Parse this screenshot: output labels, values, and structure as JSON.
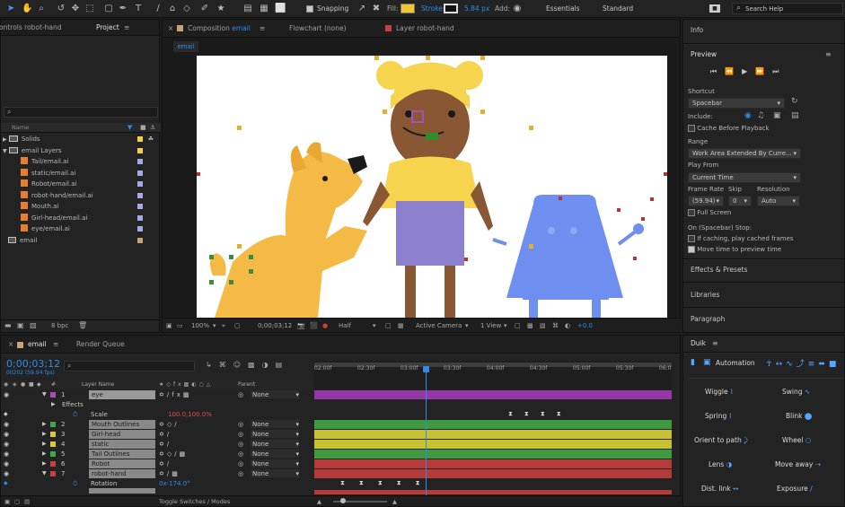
{
  "toolbar": {
    "snapping_label": "Snapping",
    "fill_label": "Fill:",
    "stroke_label": "Stroke:",
    "stroke_width": "5.84 px",
    "add_label": "Add:",
    "workspace_essentials": "Essentials",
    "workspace_standard": "Standard",
    "search_placeholder": "Search Help",
    "fill_color": "#f5c431"
  },
  "left_panel": {
    "tab_effect_controls": "ontrols robot-hand",
    "tab_project": "Project",
    "search_placeholder": "",
    "col_name": "Name",
    "items": [
      {
        "label": "Solids",
        "type": "folder",
        "color": "#f2d53c"
      },
      {
        "label": "email Layers",
        "type": "folder",
        "color": "#f2d53c"
      },
      {
        "label": "Tail/email.ai",
        "type": "ai",
        "color": "#a7a8e8"
      },
      {
        "label": "static/email.ai",
        "type": "ai",
        "color": "#a7a8e8"
      },
      {
        "label": "Robot/email.ai",
        "type": "ai",
        "color": "#a7a8e8"
      },
      {
        "label": "robot-hand/email.ai",
        "type": "ai",
        "color": "#a7a8e8"
      },
      {
        "label": "Mouth.ai",
        "type": "ai",
        "color": "#a7a8e8"
      },
      {
        "label": "Girl-head/email.ai",
        "type": "ai",
        "color": "#a7a8e8"
      },
      {
        "label": "eye/email.ai",
        "type": "ai",
        "color": "#a7a8e8"
      },
      {
        "label": "email",
        "type": "comp",
        "color": "#c8a27a"
      }
    ],
    "bpc": "8 bpc"
  },
  "comp_panel": {
    "tab_composition": "Composition",
    "tab_composition_name": "email",
    "tab_flowchart": "Flowchart (none)",
    "tab_layer": "Layer robot-hand",
    "crumb": "email",
    "zoom": "100%",
    "timecode": "0;00;03;12",
    "resolution": "Half",
    "camera": "Active Camera",
    "view": "1 View",
    "exposure": "+0.0"
  },
  "right_panel": {
    "info": "Info",
    "preview": "Preview",
    "shortcut_label": "Shortcut",
    "shortcut_value": "Spacebar",
    "include_label": "Include:",
    "cache_label": "Cache Before Playback",
    "range_label": "Range",
    "range_value": "Work Area Extended By Curre...",
    "playfrom_label": "Play From",
    "playfrom_value": "Current Time",
    "framerate_label": "Frame Rate",
    "skip_label": "Skip",
    "resolution_label": "Resolution",
    "framerate_value": "(59.94)",
    "skip_value": "0",
    "resolution_value": "Auto",
    "fullscreen_label": "Full Screen",
    "stop_label": "On (Spacebar) Stop:",
    "stop_opt1": "If caching, play cached frames",
    "stop_opt2": "Move time to preview time",
    "effects_presets": "Effects & Presets",
    "libraries": "Libraries",
    "paragraph": "Paragraph"
  },
  "timeline": {
    "tab_email": "email",
    "tab_render": "Render Queue",
    "timecode": "0;00;03;12",
    "frame_info": "00202 (59.94 fps)",
    "col_layer_name": "Layer Name",
    "col_parent": "Parent",
    "ruler": [
      "02:00f",
      "02:30f",
      "03:00f",
      "03:30f",
      "04:00f",
      "04:30f",
      "05:00f",
      "05:30f",
      "06:0"
    ],
    "layers": [
      {
        "num": "1",
        "name": "eye",
        "color": "#a84fb5",
        "parent": "None"
      },
      {
        "num": "2",
        "name": "Mouth Outlines",
        "color": "#3fa84b",
        "parent": "None"
      },
      {
        "num": "3",
        "name": "Girl-head",
        "color": "#d8c93c",
        "parent": "None"
      },
      {
        "num": "4",
        "name": "static",
        "color": "#d8c93c",
        "parent": "None"
      },
      {
        "num": "5",
        "name": "Tail Outlines",
        "color": "#3fa84b",
        "parent": "None"
      },
      {
        "num": "6",
        "name": "Robot",
        "color": "#c84040",
        "parent": "None"
      },
      {
        "num": "7",
        "name": "robot-hand",
        "color": "#c84040",
        "parent": "None"
      }
    ],
    "effects_label": "Effects",
    "scale_label": "Scale",
    "scale_value": "100.0,100.0%",
    "rotation_label": "Rotation",
    "rotation_value": "0x-174.0°",
    "toggle_label": "Toggle Switches / Modes"
  },
  "duik": {
    "title": "Duik",
    "automation": "Automation",
    "buttons": [
      "Wiggle",
      "Swing",
      "Spring",
      "Blink",
      "Orient to path",
      "Wheel",
      "Lens",
      "Move away",
      "Dist. link",
      "Exposure"
    ]
  }
}
